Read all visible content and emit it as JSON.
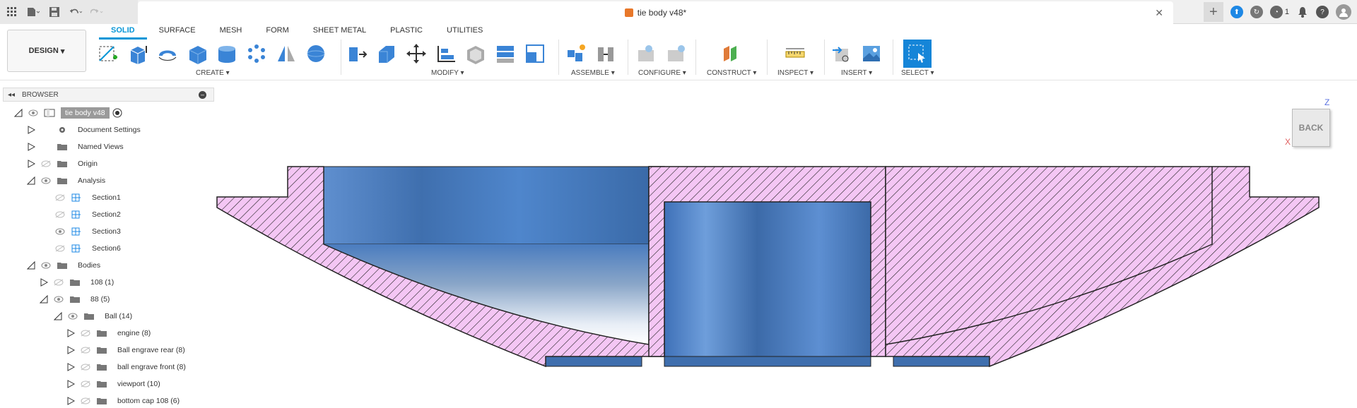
{
  "titlebar": {
    "doc_title": "tie body v48*",
    "notif_count": "1"
  },
  "ribbon": {
    "workspace": "DESIGN",
    "tabs": [
      "SOLID",
      "SURFACE",
      "MESH",
      "FORM",
      "SHEET METAL",
      "PLASTIC",
      "UTILITIES"
    ],
    "groups": [
      "CREATE",
      "MODIFY",
      "ASSEMBLE",
      "CONFIGURE",
      "CONSTRUCT",
      "INSPECT",
      "INSERT",
      "SELECT"
    ]
  },
  "browser": {
    "header": "BROWSER",
    "items": [
      {
        "label": "tie body v48"
      },
      {
        "label": "Document Settings"
      },
      {
        "label": "Named Views"
      },
      {
        "label": "Origin"
      },
      {
        "label": "Analysis"
      },
      {
        "label": "Section1"
      },
      {
        "label": "Section2"
      },
      {
        "label": "Section3"
      },
      {
        "label": "Section6"
      },
      {
        "label": "Bodies"
      },
      {
        "label": "108 (1)"
      },
      {
        "label": "88 (5)"
      },
      {
        "label": "Ball (14)"
      },
      {
        "label": "engine (8)"
      },
      {
        "label": "Ball engrave rear (8)"
      },
      {
        "label": "ball engrave front (8)"
      },
      {
        "label": "viewport (10)"
      },
      {
        "label": "bottom cap 108 (6)"
      }
    ]
  },
  "viewcube": {
    "face": "BACK",
    "axis_z": "Z",
    "axis_x": "X"
  },
  "colors": {
    "accent": "#0696d7",
    "hatch_fill": "#f4c6f4",
    "body_blue": "#4a7fc4"
  }
}
